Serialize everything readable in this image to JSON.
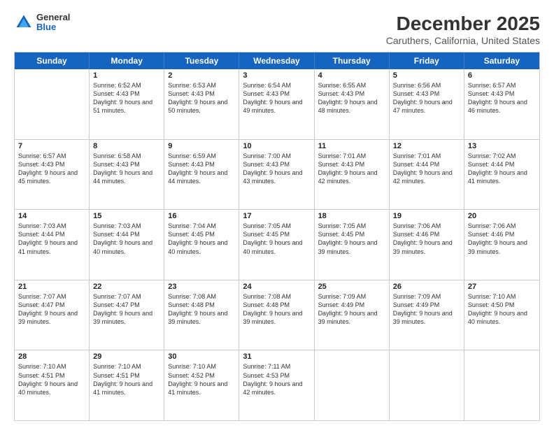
{
  "logo": {
    "general": "General",
    "blue": "Blue"
  },
  "header": {
    "title": "December 2025",
    "subtitle": "Caruthers, California, United States"
  },
  "days": [
    "Sunday",
    "Monday",
    "Tuesday",
    "Wednesday",
    "Thursday",
    "Friday",
    "Saturday"
  ],
  "weeks": [
    [
      {
        "day": "",
        "sunrise": "",
        "sunset": "",
        "daylight": ""
      },
      {
        "day": "1",
        "sunrise": "Sunrise: 6:52 AM",
        "sunset": "Sunset: 4:43 PM",
        "daylight": "Daylight: 9 hours and 51 minutes."
      },
      {
        "day": "2",
        "sunrise": "Sunrise: 6:53 AM",
        "sunset": "Sunset: 4:43 PM",
        "daylight": "Daylight: 9 hours and 50 minutes."
      },
      {
        "day": "3",
        "sunrise": "Sunrise: 6:54 AM",
        "sunset": "Sunset: 4:43 PM",
        "daylight": "Daylight: 9 hours and 49 minutes."
      },
      {
        "day": "4",
        "sunrise": "Sunrise: 6:55 AM",
        "sunset": "Sunset: 4:43 PM",
        "daylight": "Daylight: 9 hours and 48 minutes."
      },
      {
        "day": "5",
        "sunrise": "Sunrise: 6:56 AM",
        "sunset": "Sunset: 4:43 PM",
        "daylight": "Daylight: 9 hours and 47 minutes."
      },
      {
        "day": "6",
        "sunrise": "Sunrise: 6:57 AM",
        "sunset": "Sunset: 4:43 PM",
        "daylight": "Daylight: 9 hours and 46 minutes."
      }
    ],
    [
      {
        "day": "7",
        "sunrise": "Sunrise: 6:57 AM",
        "sunset": "Sunset: 4:43 PM",
        "daylight": "Daylight: 9 hours and 45 minutes."
      },
      {
        "day": "8",
        "sunrise": "Sunrise: 6:58 AM",
        "sunset": "Sunset: 4:43 PM",
        "daylight": "Daylight: 9 hours and 44 minutes."
      },
      {
        "day": "9",
        "sunrise": "Sunrise: 6:59 AM",
        "sunset": "Sunset: 4:43 PM",
        "daylight": "Daylight: 9 hours and 44 minutes."
      },
      {
        "day": "10",
        "sunrise": "Sunrise: 7:00 AM",
        "sunset": "Sunset: 4:43 PM",
        "daylight": "Daylight: 9 hours and 43 minutes."
      },
      {
        "day": "11",
        "sunrise": "Sunrise: 7:01 AM",
        "sunset": "Sunset: 4:43 PM",
        "daylight": "Daylight: 9 hours and 42 minutes."
      },
      {
        "day": "12",
        "sunrise": "Sunrise: 7:01 AM",
        "sunset": "Sunset: 4:44 PM",
        "daylight": "Daylight: 9 hours and 42 minutes."
      },
      {
        "day": "13",
        "sunrise": "Sunrise: 7:02 AM",
        "sunset": "Sunset: 4:44 PM",
        "daylight": "Daylight: 9 hours and 41 minutes."
      }
    ],
    [
      {
        "day": "14",
        "sunrise": "Sunrise: 7:03 AM",
        "sunset": "Sunset: 4:44 PM",
        "daylight": "Daylight: 9 hours and 41 minutes."
      },
      {
        "day": "15",
        "sunrise": "Sunrise: 7:03 AM",
        "sunset": "Sunset: 4:44 PM",
        "daylight": "Daylight: 9 hours and 40 minutes."
      },
      {
        "day": "16",
        "sunrise": "Sunrise: 7:04 AM",
        "sunset": "Sunset: 4:45 PM",
        "daylight": "Daylight: 9 hours and 40 minutes."
      },
      {
        "day": "17",
        "sunrise": "Sunrise: 7:05 AM",
        "sunset": "Sunset: 4:45 PM",
        "daylight": "Daylight: 9 hours and 40 minutes."
      },
      {
        "day": "18",
        "sunrise": "Sunrise: 7:05 AM",
        "sunset": "Sunset: 4:45 PM",
        "daylight": "Daylight: 9 hours and 39 minutes."
      },
      {
        "day": "19",
        "sunrise": "Sunrise: 7:06 AM",
        "sunset": "Sunset: 4:46 PM",
        "daylight": "Daylight: 9 hours and 39 minutes."
      },
      {
        "day": "20",
        "sunrise": "Sunrise: 7:06 AM",
        "sunset": "Sunset: 4:46 PM",
        "daylight": "Daylight: 9 hours and 39 minutes."
      }
    ],
    [
      {
        "day": "21",
        "sunrise": "Sunrise: 7:07 AM",
        "sunset": "Sunset: 4:47 PM",
        "daylight": "Daylight: 9 hours and 39 minutes."
      },
      {
        "day": "22",
        "sunrise": "Sunrise: 7:07 AM",
        "sunset": "Sunset: 4:47 PM",
        "daylight": "Daylight: 9 hours and 39 minutes."
      },
      {
        "day": "23",
        "sunrise": "Sunrise: 7:08 AM",
        "sunset": "Sunset: 4:48 PM",
        "daylight": "Daylight: 9 hours and 39 minutes."
      },
      {
        "day": "24",
        "sunrise": "Sunrise: 7:08 AM",
        "sunset": "Sunset: 4:48 PM",
        "daylight": "Daylight: 9 hours and 39 minutes."
      },
      {
        "day": "25",
        "sunrise": "Sunrise: 7:09 AM",
        "sunset": "Sunset: 4:49 PM",
        "daylight": "Daylight: 9 hours and 39 minutes."
      },
      {
        "day": "26",
        "sunrise": "Sunrise: 7:09 AM",
        "sunset": "Sunset: 4:49 PM",
        "daylight": "Daylight: 9 hours and 39 minutes."
      },
      {
        "day": "27",
        "sunrise": "Sunrise: 7:10 AM",
        "sunset": "Sunset: 4:50 PM",
        "daylight": "Daylight: 9 hours and 40 minutes."
      }
    ],
    [
      {
        "day": "28",
        "sunrise": "Sunrise: 7:10 AM",
        "sunset": "Sunset: 4:51 PM",
        "daylight": "Daylight: 9 hours and 40 minutes."
      },
      {
        "day": "29",
        "sunrise": "Sunrise: 7:10 AM",
        "sunset": "Sunset: 4:51 PM",
        "daylight": "Daylight: 9 hours and 41 minutes."
      },
      {
        "day": "30",
        "sunrise": "Sunrise: 7:10 AM",
        "sunset": "Sunset: 4:52 PM",
        "daylight": "Daylight: 9 hours and 41 minutes."
      },
      {
        "day": "31",
        "sunrise": "Sunrise: 7:11 AM",
        "sunset": "Sunset: 4:53 PM",
        "daylight": "Daylight: 9 hours and 42 minutes."
      },
      {
        "day": "",
        "sunrise": "",
        "sunset": "",
        "daylight": ""
      },
      {
        "day": "",
        "sunrise": "",
        "sunset": "",
        "daylight": ""
      },
      {
        "day": "",
        "sunrise": "",
        "sunset": "",
        "daylight": ""
      }
    ]
  ]
}
